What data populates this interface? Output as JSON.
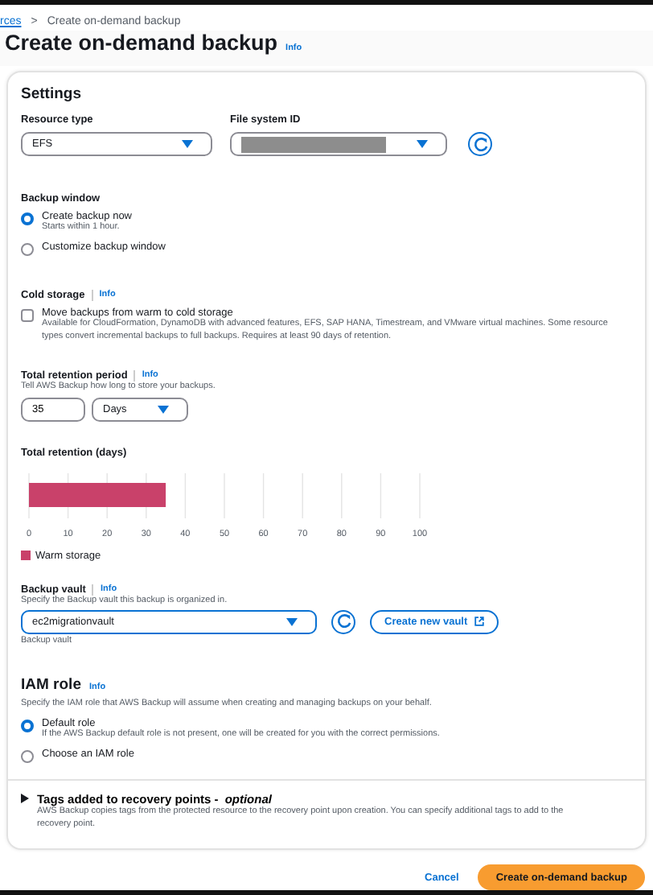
{
  "breadcrumb": {
    "items": [
      {
        "label": "rces",
        "kind": "link"
      },
      {
        "label": "Create on-demand backup",
        "kind": "current"
      }
    ],
    "separator": ">"
  },
  "page_title": {
    "text": "Create on-demand backup",
    "info": "Info"
  },
  "settings": {
    "title": "Settings",
    "resource_type": {
      "label": "Resource type",
      "value": "EFS"
    },
    "file_system_id": {
      "label": "File system ID"
    },
    "backup_window": {
      "label": "Backup window",
      "options": [
        {
          "label": "Create backup now",
          "hint": "Starts within 1 hour.",
          "selected": true
        },
        {
          "label": "Customize backup window",
          "selected": false
        }
      ]
    },
    "cold_storage": {
      "label": "Cold storage",
      "info": "Info",
      "option": {
        "label": "Move backups from warm to cold storage",
        "checked": false,
        "description": "Available for CloudFormation, DynamoDB with advanced features, EFS, SAP HANA, Timestream, and VMware virtual machines. Some resource types convert incremental backups to full backups. Requires at least 90 days of retention."
      }
    },
    "retention": {
      "label": "Total retention period",
      "info": "Info",
      "description": "Tell AWS Backup how long to store your backups.",
      "value": "35",
      "unit": "Days"
    },
    "retention_chart": {
      "chart_data": {
        "type": "bar",
        "orientation": "horizontal",
        "title": "Total retention (days)",
        "grid": true,
        "series": [
          {
            "name": "Warm storage",
            "color": "#c9416a",
            "values": [
              35
            ]
          }
        ],
        "xlim": [
          0,
          100
        ],
        "xticks": [
          0,
          10,
          20,
          30,
          40,
          50,
          60,
          70,
          80,
          90,
          100
        ]
      }
    },
    "backup_vault": {
      "label": "Backup vault",
      "info": "Info",
      "description": "Specify the Backup vault this backup is organized in.",
      "value": "ec2migrationvault",
      "hint": "Backup vault",
      "create_button": "Create new vault"
    },
    "iam_role": {
      "title": "IAM role",
      "info": "Info",
      "description": "Specify the IAM role that AWS Backup will assume when creating and managing backups on your behalf.",
      "options": [
        {
          "label": "Default role",
          "hint": "If the AWS Backup default role is not present, one will be created for you with the correct permissions.",
          "selected": true
        },
        {
          "label": "Choose an IAM role",
          "selected": false
        }
      ]
    },
    "tags": {
      "title": "Tags added to recovery points - *optional*",
      "expanded": false,
      "description": "AWS Backup copies tags from the protected resource to the recovery point upon creation. You can specify additional tags to add to the recovery point."
    }
  },
  "actions": {
    "cancel": "Cancel",
    "submit": "Create on-demand backup"
  }
}
